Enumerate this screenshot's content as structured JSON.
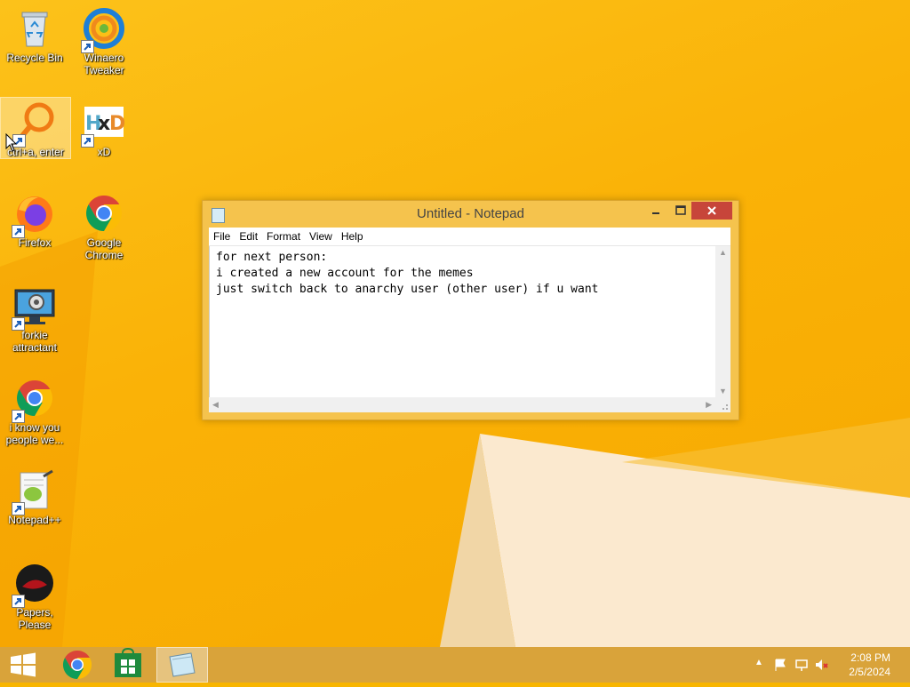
{
  "desktop_icons": [
    {
      "label": "Recycle Bin",
      "icon": "recycle-bin-icon"
    },
    {
      "label": "Winaero Tweaker",
      "icon": "winaero-tweaker-icon"
    },
    {
      "label": "ctrl+a, enter",
      "icon": "search-magnifier-icon"
    },
    {
      "label": "xD",
      "icon": "hxd-icon"
    },
    {
      "label": "Firefox",
      "icon": "firefox-icon"
    },
    {
      "label": "Google Chrome",
      "icon": "chrome-icon"
    },
    {
      "label": "forkie attractant",
      "icon": "settings-monitor-icon"
    },
    {
      "label": "i know you people we...",
      "icon": "chrome-icon"
    },
    {
      "label": "Notepad++",
      "icon": "notepad-plus-plus-icon"
    },
    {
      "label": "Papers, Please",
      "icon": "papers-please-icon"
    }
  ],
  "notepad": {
    "title": "Untitled - Notepad",
    "menu": [
      "File",
      "Edit",
      "Format",
      "View",
      "Help"
    ],
    "text": "for next person:\ni created a new account for the memes\njust switch back to anarchy user (other user) if u want"
  },
  "taskbar": {
    "time": "2:08 PM",
    "date": "2/5/2024"
  },
  "colors": {
    "desktop": "#f8b500",
    "close_button": "#c7453a",
    "taskbar": "#d9a33a"
  }
}
